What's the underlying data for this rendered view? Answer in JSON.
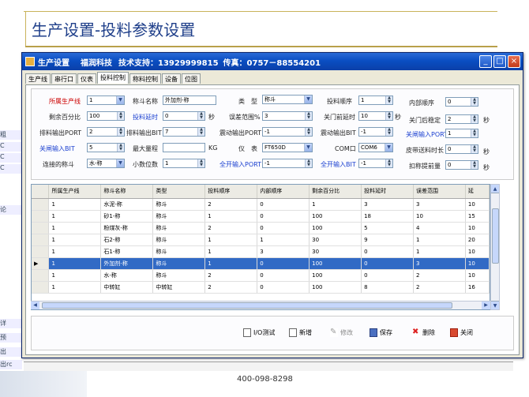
{
  "slide": {
    "title": "生产设置-投料参数设置",
    "footer_phone": "400-098-8298",
    "left_fragments": [
      "粗",
      "C",
      "C",
      "C",
      "论",
      "",
      "",
      "详",
      "预",
      "出",
      "出rc"
    ]
  },
  "window": {
    "title": "生产设置",
    "company": "福润科技",
    "support": "技术支持：13929999815",
    "fax": "传真：0757－88554201",
    "min": "_",
    "max": "□",
    "close": "×"
  },
  "tabs": [
    "生产线",
    "串行口",
    "仪表",
    "投料控制",
    "称料控制",
    "设备",
    "位图"
  ],
  "form": {
    "r1": {
      "line_lbl": "所属生产线",
      "line_val": "1",
      "name_lbl": "称斗名称",
      "name_val": "外加剂-称",
      "type_lbl": "类　型",
      "type_val": "称斗",
      "order_lbl": "投料顺序",
      "order_val": "1",
      "inner_lbl": "内部顺序",
      "inner_val": "0"
    },
    "r2": {
      "rem_lbl": "剩余百分比",
      "rem_val": "100",
      "delay_lbl": "投料延时",
      "delay_val": "0",
      "delay_unit": "秒",
      "err_lbl": "误差范围%",
      "err_val": "3",
      "gate_lbl": "关门前延时",
      "gate_val": "10",
      "gate_unit": "秒",
      "stable_lbl": "关门后稳定",
      "stable_val": "2",
      "stable_unit": "秒"
    },
    "r3": {
      "port_lbl": "排料输出PORT",
      "port_val": "2",
      "bit_lbl": "排料输出BIT",
      "bit_val": "7",
      "vport_lbl": "震动输出PORT",
      "vport_val": "-1",
      "vbit_lbl": "震动输出BIT",
      "vbit_val": "-1",
      "cport_lbl": "关闸输入PORT",
      "cport_val": "1"
    },
    "r4": {
      "cbit_lbl": "关闸输入BIT",
      "cbit_val": "5",
      "max_lbl": "最大量程",
      "max_val": "",
      "max_unit": "KG",
      "meter_lbl": "仪　表",
      "meter_val": "FT650D",
      "com_lbl": "COM口",
      "com_val": "COM6",
      "belt_lbl": "皮带送料时长",
      "belt_val": "0",
      "belt_unit": "秒"
    },
    "r5": {
      "link_lbl": "连接的称斗",
      "link_val": "水-称",
      "dec_lbl": "小数位数",
      "dec_val": "1",
      "aport_lbl": "全开输入PORT",
      "aport_val": "-1",
      "abit_lbl": "全开输入BIT",
      "abit_val": "-1",
      "deduct_lbl": "扣称提前量",
      "deduct_val": "0",
      "deduct_unit": "秒"
    }
  },
  "grid": {
    "headers": [
      "所属生产线",
      "称斗名称",
      "类型",
      "投料顺序",
      "内部顺序",
      "剩余百分比",
      "投料延时",
      "误差范围",
      "延"
    ],
    "rows": [
      [
        "1",
        "水泥-称",
        "称斗",
        "2",
        "0",
        "1",
        "3",
        "3",
        "10"
      ],
      [
        "1",
        "砂1-称",
        "称斗",
        "1",
        "0",
        "100",
        "18",
        "10",
        "15"
      ],
      [
        "1",
        "粉煤灰-称",
        "称斗",
        "2",
        "0",
        "100",
        "5",
        "4",
        "10"
      ],
      [
        "1",
        "石2-称",
        "称斗",
        "1",
        "1",
        "30",
        "9",
        "1",
        "20"
      ],
      [
        "1",
        "石1-称",
        "称斗",
        "1",
        "3",
        "30",
        "0",
        "1",
        "10"
      ],
      [
        "1",
        "外加剂-称",
        "称斗",
        "1",
        "0",
        "100",
        "0",
        "3",
        "10"
      ],
      [
        "1",
        "水-称",
        "称斗",
        "2",
        "0",
        "100",
        "0",
        "2",
        "10"
      ],
      [
        "1",
        "中转缸",
        "中转缸",
        "2",
        "0",
        "100",
        "8",
        "2",
        "16"
      ]
    ],
    "selected_index": 5,
    "selected_marker": "▶"
  },
  "buttons": {
    "io": "I/O测试",
    "add": "新增",
    "edit": "修改",
    "save": "保存",
    "del": "删除",
    "exit": "关闭"
  }
}
